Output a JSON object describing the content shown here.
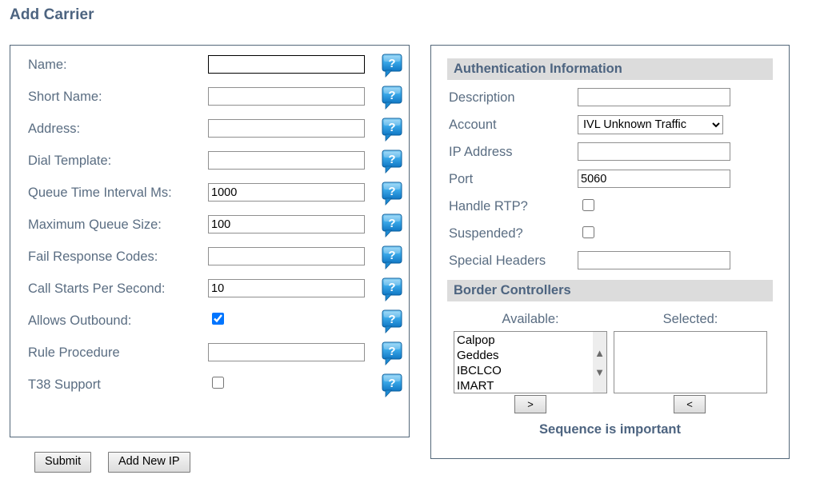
{
  "page": {
    "title": "Add Carrier"
  },
  "carrier_form": {
    "fields": [
      {
        "label": "Name:",
        "type": "text",
        "value": "",
        "focused": true,
        "help_icon": "help-speech-bubble-icon"
      },
      {
        "label": "Short Name:",
        "type": "text",
        "value": "",
        "focused": false,
        "help_icon": "help-speech-bubble-icon"
      },
      {
        "label": "Address:",
        "type": "text",
        "value": "",
        "focused": false,
        "help_icon": "help-speech-bubble-icon"
      },
      {
        "label": "Dial Template:",
        "type": "text",
        "value": "",
        "focused": false,
        "help_icon": "help-speech-bubble-icon"
      },
      {
        "label": "Queue Time Interval Ms:",
        "type": "text",
        "value": "1000",
        "focused": false,
        "help_icon": "help-speech-bubble-icon"
      },
      {
        "label": "Maximum Queue Size:",
        "type": "text",
        "value": "100",
        "focused": false,
        "help_icon": "help-speech-bubble-icon"
      },
      {
        "label": "Fail Response Codes:",
        "type": "text",
        "value": "",
        "focused": false,
        "help_icon": "help-speech-bubble-icon"
      },
      {
        "label": "Call Starts Per Second:",
        "type": "text",
        "value": "10",
        "focused": false,
        "help_icon": "help-speech-bubble-icon"
      },
      {
        "label": "Allows Outbound:",
        "type": "checkbox",
        "checked": true,
        "help_icon": "help-speech-bubble-icon"
      },
      {
        "label": "Rule Procedure",
        "type": "text",
        "value": "",
        "focused": false,
        "help_icon": "help-speech-bubble-icon"
      },
      {
        "label": "T38 Support",
        "type": "checkbox",
        "checked": false,
        "help_icon": "help-speech-bubble-icon"
      }
    ],
    "submit_label": "Submit",
    "add_new_ip_label": "Add New IP"
  },
  "authentication": {
    "section_title": "Authentication Information",
    "fields": [
      {
        "label": "Description",
        "type": "text",
        "value": ""
      },
      {
        "label": "Account",
        "type": "select",
        "value": "IVL Unknown Traffic",
        "options": [
          "IVL Unknown Traffic"
        ]
      },
      {
        "label": "IP Address",
        "type": "text",
        "value": ""
      },
      {
        "label": "Port",
        "type": "text",
        "value": "5060"
      },
      {
        "label": "Handle RTP?",
        "type": "checkbox",
        "checked": false
      },
      {
        "label": "Suspended?",
        "type": "checkbox",
        "checked": false
      },
      {
        "label": "Special Headers",
        "type": "text",
        "value": ""
      }
    ]
  },
  "border_controllers": {
    "section_title": "Border Controllers",
    "available_caption": "Available:",
    "selected_caption": "Selected:",
    "available_items": [
      "Calpop",
      "Geddes",
      "IBCLCO",
      "IMART"
    ],
    "selected_items": [],
    "move_right_label": ">",
    "move_left_label": "<",
    "scroll_up_icon": "chevron-up-icon",
    "scroll_down_icon": "chevron-down-icon",
    "note": "Sequence is important"
  },
  "colors": {
    "title_text": "#4d6480",
    "label_text": "#5a6d82",
    "panel_border": "#536779",
    "section_header_bg": "#dcdcdc",
    "input_border": "#8f8f8f",
    "focused_input_border": "#000000",
    "help_icon_blue": "#2e9ee0",
    "page_bg": "#ffffff"
  }
}
